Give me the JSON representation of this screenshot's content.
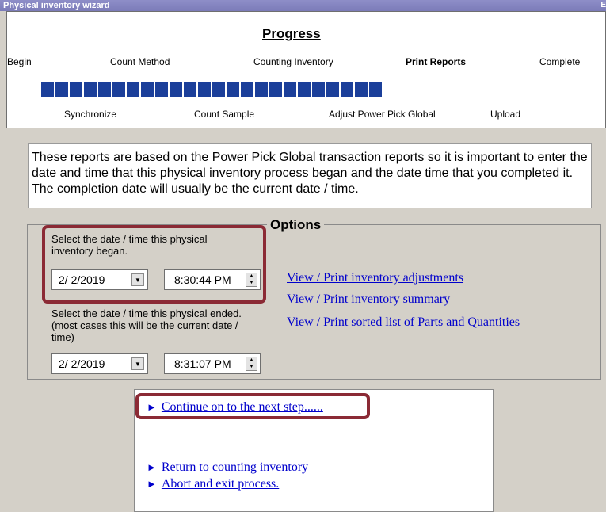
{
  "window": {
    "title": "Physical inventory wizard",
    "close_glyph": "E"
  },
  "progress": {
    "title": "Progress",
    "steps_top": [
      "Begin",
      "Count Method",
      "Counting Inventory",
      "Print Reports",
      "Complete"
    ],
    "steps_bottom": [
      "Synchronize",
      "Count Sample",
      "Adjust Power Pick Global",
      "Upload"
    ],
    "current_step": "Print Reports",
    "bar_segments": 24
  },
  "description": "These reports are based on the Power Pick Global transaction reports so it is important to enter the date and time that this physical inventory process began and the date time that you completed it.  The completion date will usually be the current date / time.",
  "options": {
    "title": "Options",
    "start_label": "Select the date / time this physical inventory began.",
    "start_date": "2/ 2/2019",
    "start_time": "8:30:44 PM",
    "end_label": "Select the date / time this physical ended.  (most cases this will be the current date / time)",
    "end_date": "2/ 2/2019",
    "end_time": "8:31:07 PM",
    "links": [
      "View / Print inventory adjustments",
      "View / Print inventory summary",
      "View / Print sorted list of Parts and Quantities"
    ]
  },
  "navigation": {
    "arrow_glyph": "►",
    "continue": "Continue on to the next step......",
    "return": "Return to counting inventory",
    "abort": "Abort and exit process."
  },
  "colors": {
    "highlight": "#8b2a35",
    "bar": "#1b3f9a",
    "link": "#0000cc",
    "background": "#d4d0c8"
  }
}
